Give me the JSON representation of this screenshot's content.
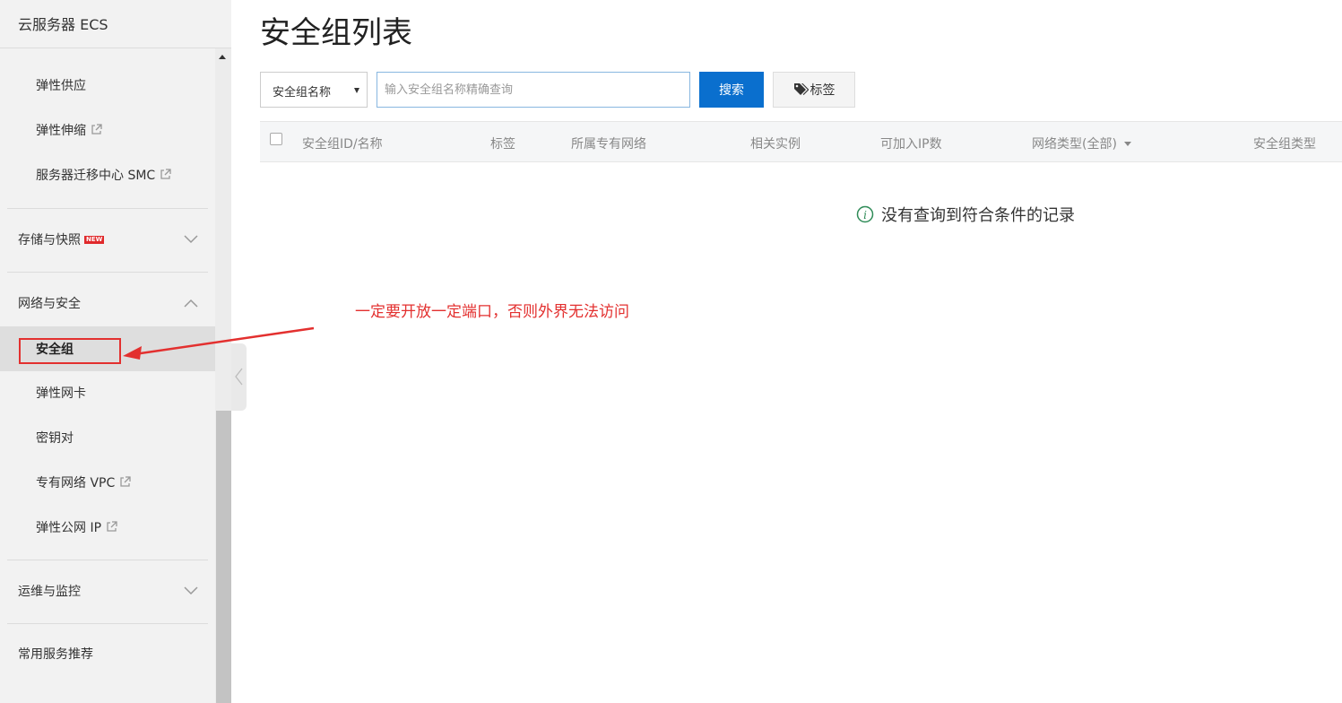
{
  "sidebar": {
    "title": "云服务器 ECS",
    "items_top": [
      {
        "label": "弹性供应",
        "external": false
      },
      {
        "label": "弹性伸缩",
        "external": true
      },
      {
        "label": "服务器迁移中心 SMC",
        "external": true
      }
    ],
    "groups": {
      "storage": {
        "label": "存储与快照",
        "badge": "NEW",
        "expanded": false
      },
      "network": {
        "label": "网络与安全",
        "expanded": true
      },
      "ops": {
        "label": "运维与监控",
        "expanded": false
      },
      "common": {
        "label": "常用服务推荐"
      }
    },
    "network_items": [
      {
        "label": "安全组",
        "active": true,
        "external": false
      },
      {
        "label": "弹性网卡",
        "external": false
      },
      {
        "label": "密钥对",
        "external": false
      },
      {
        "label": "专有网络 VPC",
        "external": true
      },
      {
        "label": "弹性公网 IP",
        "external": true
      }
    ]
  },
  "main": {
    "title": "安全组列表",
    "filter": {
      "selected": "安全组名称",
      "placeholder": "输入安全组名称精确查询",
      "search_label": "搜索",
      "tag_label": "标签"
    },
    "table": {
      "columns": [
        "安全组ID/名称",
        "标签",
        "所属专有网络",
        "相关实例",
        "可加入IP数",
        "网络类型(全部)",
        "安全组类型"
      ],
      "rows": []
    },
    "empty_message": "没有查询到符合条件的记录"
  },
  "annotation": {
    "text": "一定要开放一定端口，否则外界无法访问",
    "color": "#e3302f"
  },
  "colors": {
    "primary": "#0a6fce",
    "annotation": "#e3302f",
    "success": "#2e8b57",
    "badge": "#e0292b"
  }
}
